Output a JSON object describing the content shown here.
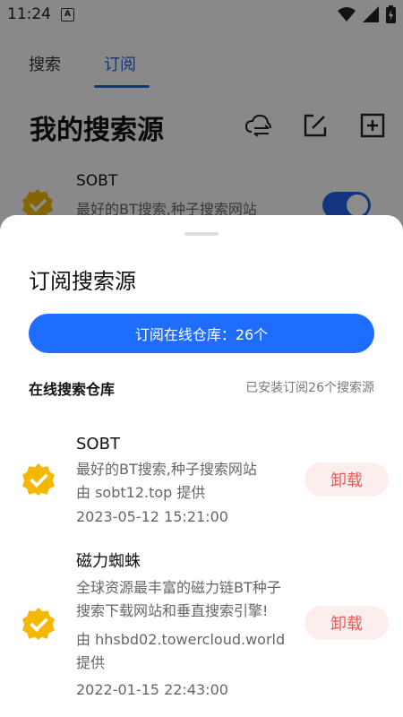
{
  "status_bar": {
    "time": "11:24",
    "a_badge": "A"
  },
  "tabs": [
    {
      "label": "搜索"
    },
    {
      "label": "订阅"
    }
  ],
  "page": {
    "title": "我的搜索源"
  },
  "background_item": {
    "name": "SOBT",
    "desc": "最好的BT搜索,种子搜索网站",
    "enabled": true
  },
  "sheet": {
    "title": "订阅搜索源",
    "button_label": "订阅在线仓库：26个",
    "section_label": "在线搜索仓库",
    "section_note": "已安装订阅26个搜索源",
    "items": [
      {
        "name": "SOBT",
        "desc": "最好的BT搜索,种子搜索网站",
        "provider": "由 sobt12.top 提供",
        "date": "2023-05-12 15:21:00",
        "action": "卸载"
      },
      {
        "name": "磁力蜘蛛",
        "desc1": "全球资源最丰富的磁力链BT种子",
        "desc2": "搜索下载网站和垂直搜索引擎!",
        "provider1": "由 hhsbd02.towercloud.world",
        "provider2": "提供",
        "date": "2022-01-15 22:43:00",
        "action": "卸载"
      }
    ]
  },
  "colors": {
    "accent": "#1f6dff",
    "danger": "#e35b5b",
    "badge": "#f5b800"
  }
}
